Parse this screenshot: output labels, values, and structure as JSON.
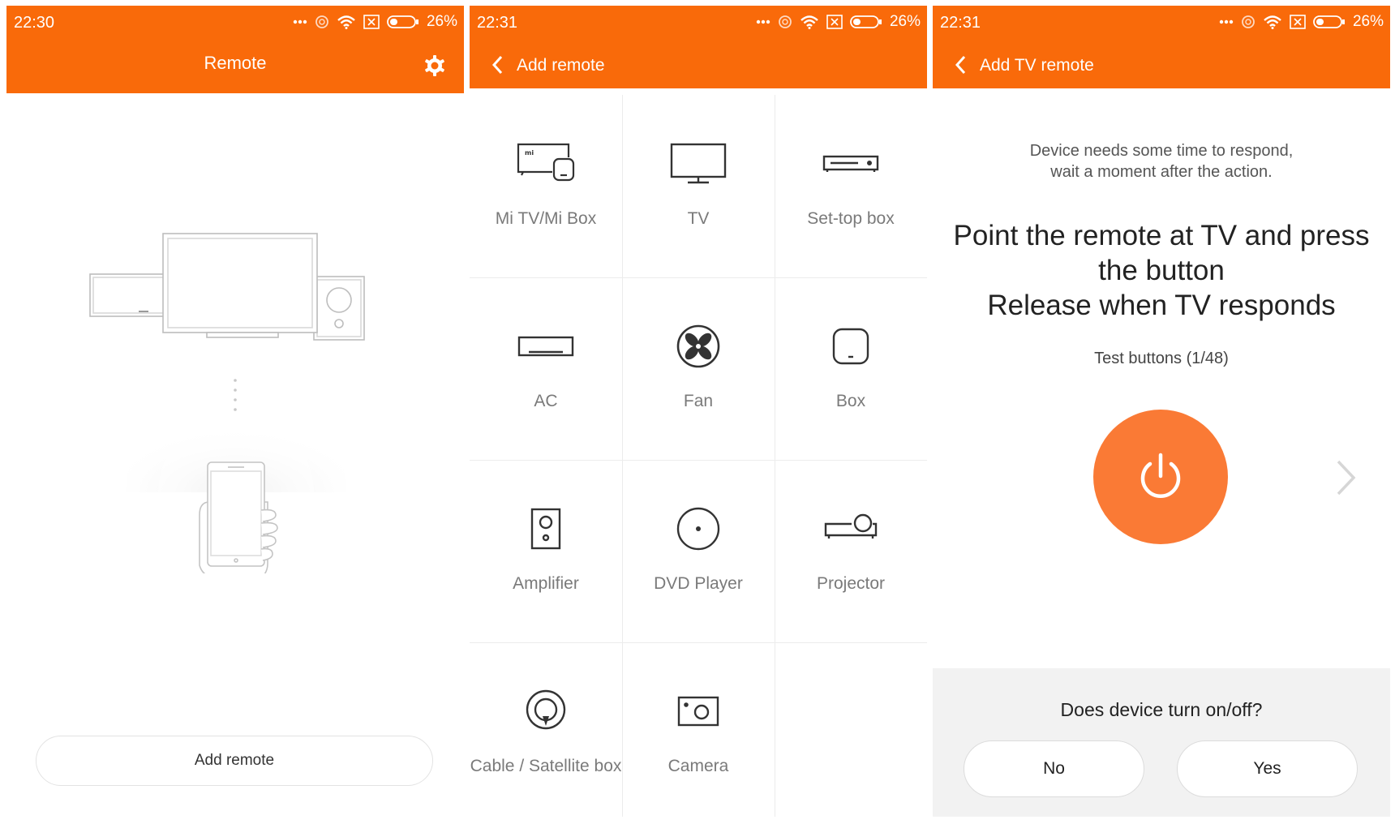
{
  "colors": {
    "brand": "#f96a0a",
    "power_button": "#fa7a35",
    "panel_bg": "#f2f2f2"
  },
  "status_icons": [
    "more-dots-icon",
    "alarm-icon",
    "wifi-icon",
    "sim-x-icon",
    "battery-icon"
  ],
  "screen1": {
    "status": {
      "time": "22:30",
      "battery": "26%"
    },
    "title": "Remote",
    "settings_icon": "gear-icon",
    "add_remote_label": "Add remote"
  },
  "screen2": {
    "status": {
      "time": "22:31",
      "battery": "26%"
    },
    "title": "Add remote",
    "devices": [
      {
        "label": "Mi TV/Mi Box",
        "icon": "mi-tv-box-icon"
      },
      {
        "label": "TV",
        "icon": "tv-icon"
      },
      {
        "label": "Set-top box",
        "icon": "set-top-box-icon"
      },
      {
        "label": "AC",
        "icon": "ac-icon"
      },
      {
        "label": "Fan",
        "icon": "fan-icon"
      },
      {
        "label": "Box",
        "icon": "box-icon"
      },
      {
        "label": "Amplifier",
        "icon": "amplifier-icon"
      },
      {
        "label": "DVD Player",
        "icon": "dvd-player-icon"
      },
      {
        "label": "Projector",
        "icon": "projector-icon"
      },
      {
        "label": "Cable / Satellite box",
        "icon": "cable-satellite-icon"
      },
      {
        "label": "Camera",
        "icon": "camera-icon"
      }
    ]
  },
  "screen3": {
    "status": {
      "time": "22:31",
      "battery": "26%"
    },
    "title": "Add TV remote",
    "note_line1": "Device needs some time to respond,",
    "note_line2": "wait a moment after the action.",
    "instr_line1": "Point the remote at TV and press",
    "instr_line2": "the button",
    "instr_line3": "Release when TV responds",
    "test_counter": "Test buttons (1/48)",
    "question": "Does device turn on/off?",
    "no_label": "No",
    "yes_label": "Yes"
  }
}
